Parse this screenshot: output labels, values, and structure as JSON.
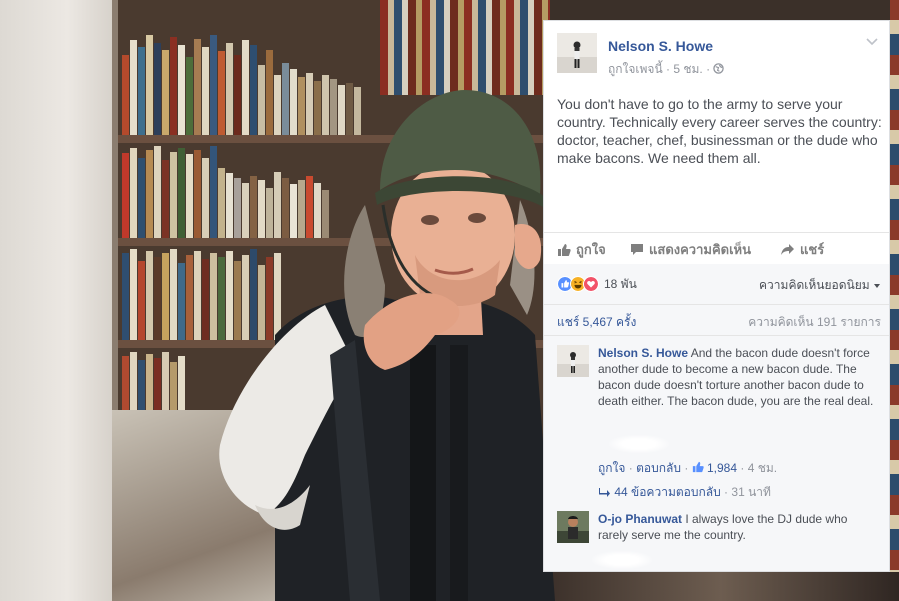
{
  "post": {
    "author": "Nelson S. Howe",
    "page_like": "ถูกใจเพจนี้",
    "separator": "·",
    "time": "5 ชม.",
    "text": "You don't have to go to the army to serve your country. Technically every career serves the country: doctor, teacher, chef, businessman or the dude who make bacons. We need them all."
  },
  "actions": {
    "like": "ถูกใจ",
    "comment": "แสดงความคิดเห็น",
    "share": "แชร์"
  },
  "stats": {
    "reactions": "18 พัน",
    "top_comments": "ความคิดเห็นยอดนิยม",
    "shares": "แชร์ 5,467 ครั้ง",
    "comments": "ความคิดเห็น 191 รายการ"
  },
  "comments": [
    {
      "author": "Nelson S. Howe",
      "text": "And the bacon dude doesn't force another dude to become a new bacon dude. The bacon dude doesn't torture another bacon dude to death either. The bacon dude, you are the real deal.",
      "like": "ถูกใจ",
      "reply": "ตอบกลับ",
      "likes": "1,984",
      "time": "4 ชม.",
      "replies": "44 ข้อความตอบกลับ",
      "replies_time": "31 นาที"
    },
    {
      "author": "O-jo Phanuwat",
      "text": "I always love the DJ dude who rarely serve me the country."
    }
  ],
  "colors": {
    "link": "#365899",
    "text": "#4b4f56",
    "muted": "#90949c",
    "like_blue": "#5890ff",
    "haha_yellow": "#f7b125",
    "love_red": "#f25268",
    "helmet": "#4e5b45"
  },
  "icons": [
    "thumbs-up-icon",
    "comment-icon",
    "share-icon",
    "globe-icon",
    "chevron-down-icon",
    "like-reaction-icon",
    "haha-reaction-icon",
    "love-reaction-icon",
    "reply-arrow-icon"
  ]
}
